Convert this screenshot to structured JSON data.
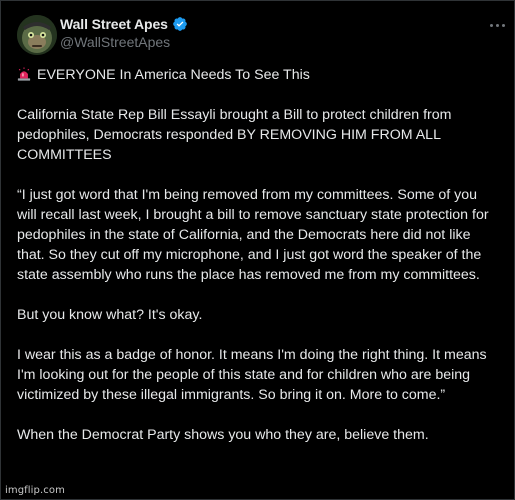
{
  "tweet": {
    "display_name": "Wall Street Apes",
    "handle": "@WallStreetApes",
    "paragraphs": [
      "EVERYONE In America Needs To See This",
      "California State Rep Bill Essayli brought a Bill to protect children from pedophiles, Democrats responded BY REMOVING HIM FROM ALL COMMITTEES",
      "“I just got word that I'm being removed from my committees. Some of you will recall last week, I brought a bill to remove sanctuary state protection for pedophiles in the state of California, and the Democrats here did not like that. So they cut off my microphone, and I just got word the speaker of the state assembly who runs the place has removed me from my committees.",
      "But you know what? It's okay.",
      "I wear this as a badge of honor. It means I'm doing the right thing. It means I'm looking out for the people of this state and for children who are being victimized by these illegal immigrants. So bring it on. More to come.”",
      "When the Democrat Party shows you who they are, believe them."
    ]
  },
  "icons": {
    "verified": "verified-badge-icon",
    "alarm": "police-light-icon",
    "more": "more-options-icon"
  },
  "colors": {
    "background": "#000000",
    "text": "#e7e9ea",
    "secondary": "#71767b",
    "verified": "#1d9bf0",
    "alarm": "#e0245e"
  },
  "watermark": "imgflip.com"
}
